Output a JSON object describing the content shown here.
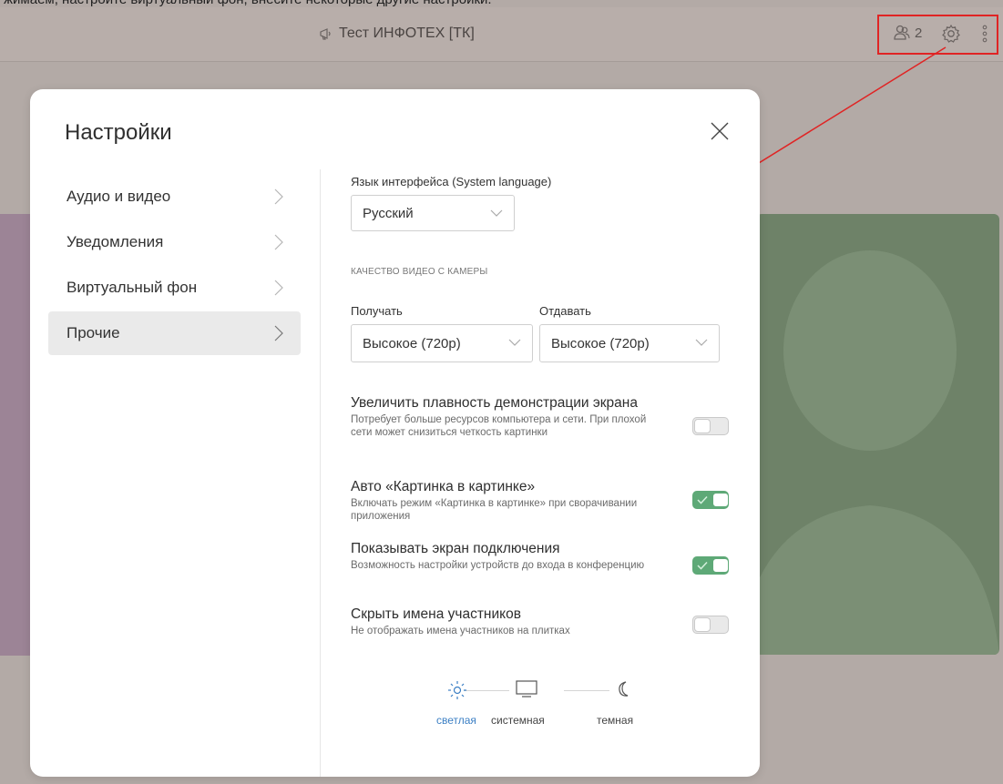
{
  "caption": "жимаем, настройте виртуальный фон, внесите некоторые другие настройки.",
  "topbar": {
    "conference_title": "Тест ИНФОТЕХ [ТК]",
    "participants_count": "2",
    "icons": [
      "megaphone-icon",
      "participants-icon",
      "gear-icon",
      "more-vertical-icon"
    ]
  },
  "colors": {
    "accent_toggle": "#5ea977",
    "highlight_box": "#e02424",
    "active_theme": "#3b7fc4"
  },
  "modal": {
    "title": "Настройки",
    "menu": [
      {
        "label": "Аудио и видео",
        "active": false
      },
      {
        "label": "Уведомления",
        "active": false
      },
      {
        "label": "Виртуальный фон",
        "active": false
      },
      {
        "label": "Прочие",
        "active": true
      }
    ],
    "language": {
      "label": "Язык интерфейса (System language)",
      "value": "Русский"
    },
    "video_quality": {
      "caption": "КАЧЕСТВО ВИДЕО С КАМЕРЫ",
      "receive_label": "Получать",
      "receive_value": "Высокое (720р)",
      "send_label": "Отдавать",
      "send_value": "Высокое (720р)"
    },
    "options": [
      {
        "title": "Увеличить плавность демонстрации экрана",
        "desc": "Потребует больше ресурсов компьютера и сети. При плохой сети может снизиться четкость картинки",
        "enabled": false
      },
      {
        "title": "Авто «Картинка в картинке»",
        "desc": "Включать режим «Картинка в картинке» при сворачивании приложения",
        "enabled": true
      },
      {
        "title": "Показывать экран подключения",
        "desc": "Возможность настройки устройств до входа в конференцию",
        "enabled": true
      },
      {
        "title": "Скрыть имена участников",
        "desc": "Не отображать имена участников на плитках",
        "enabled": false
      }
    ],
    "theme": {
      "options": [
        "светлая",
        "системная",
        "темная"
      ],
      "selected": "светлая"
    }
  }
}
